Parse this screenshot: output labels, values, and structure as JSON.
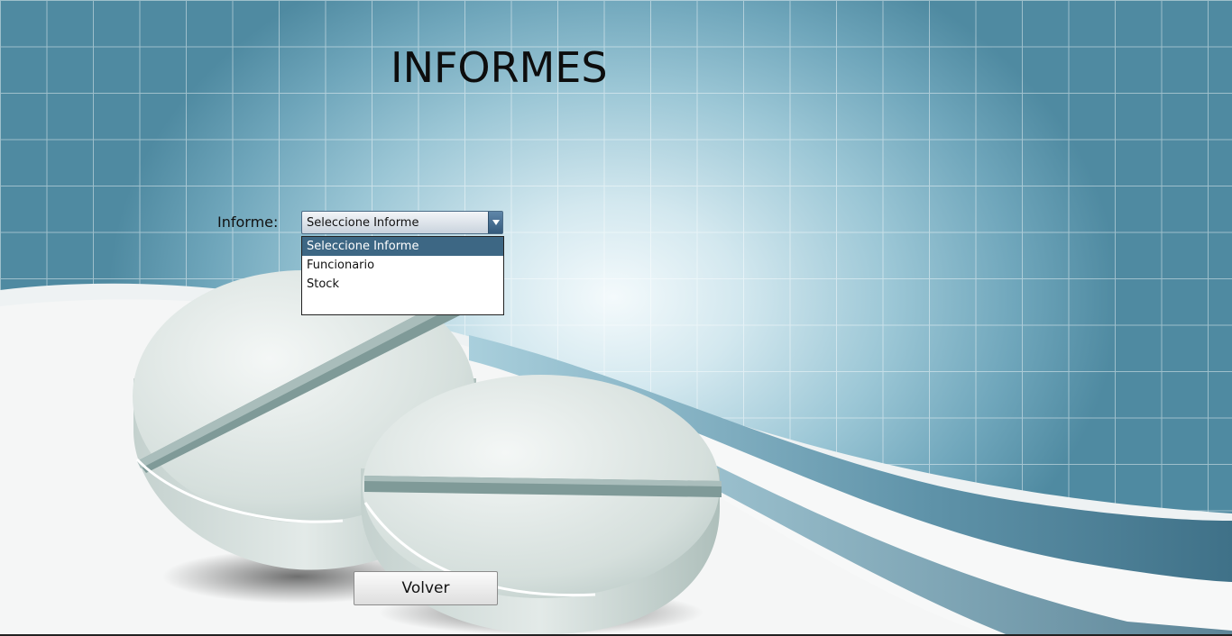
{
  "page": {
    "title": "INFORMES"
  },
  "form": {
    "report_label": "Informe:",
    "report_select": {
      "selected": "Seleccione Informe",
      "options": [
        "Seleccione Informe",
        "Funcionario",
        "Stock"
      ],
      "expanded": true
    }
  },
  "actions": {
    "back_label": "Volver"
  },
  "colors": {
    "selection": "#3d6784",
    "background_accent": "#4f8aa1"
  }
}
